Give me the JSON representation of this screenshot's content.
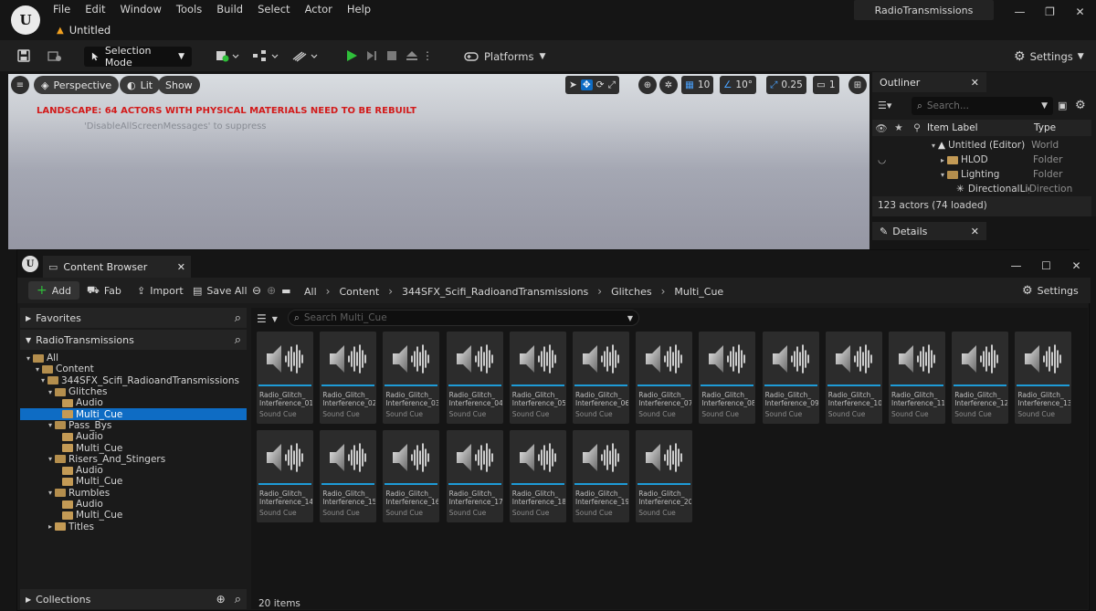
{
  "menu": [
    "File",
    "Edit",
    "Window",
    "Tools",
    "Build",
    "Select",
    "Actor",
    "Help"
  ],
  "doc_tab": "Untitled",
  "project_name": "RadioTransmissions",
  "toolbar": {
    "selection_mode": "Selection Mode",
    "platforms": "Platforms",
    "settings": "Settings"
  },
  "viewport": {
    "perspective": "Perspective",
    "lit": "Lit",
    "show": "Show",
    "warning": "LANDSCAPE: 64 ACTORS WITH PHYSICAL MATERIALS NEED TO BE REBUILT",
    "suppress_hint": "'DisableAllScreenMessages' to suppress",
    "grid_snap": "10",
    "rot_snap": "10°",
    "scale_snap": "0.25",
    "camera_speed": "1"
  },
  "outliner": {
    "title": "Outliner",
    "search_placeholder": "Search...",
    "col_label": "Item Label",
    "col_type": "Type",
    "rows": [
      {
        "label": "Untitled (Editor)",
        "type": "World"
      },
      {
        "label": "HLOD",
        "type": "Folder"
      },
      {
        "label": "Lighting",
        "type": "Folder"
      },
      {
        "label": "DirectionalLig",
        "type": "Direction"
      }
    ],
    "actors": "123 actors (74 loaded)"
  },
  "details": {
    "title": "Details"
  },
  "content_browser": {
    "title": "Content Browser",
    "add": "Add",
    "fab": "Fab",
    "import": "Import",
    "save_all": "Save All",
    "breadcrumb": [
      "All",
      "Content",
      "344SFX_Scifi_RadioandTransmissions",
      "Glitches",
      "Multi_Cue"
    ],
    "settings": "Settings",
    "favorites": "Favorites",
    "project_section": "RadioTransmissions",
    "collections": "Collections",
    "search_placeholder": "Search Multi_Cue",
    "item_count": "20 items",
    "tree": {
      "all": "All",
      "content": "Content",
      "pack": "344SFX_Scifi_RadioandTransmissions",
      "glitches": "Glitches",
      "glitches_audio": "Audio",
      "glitches_multi": "Multi_Cue",
      "pass_bys": "Pass_Bys",
      "pass_audio": "Audio",
      "pass_multi": "Multi_Cue",
      "risers": "Risers_And_Stingers",
      "risers_audio": "Audio",
      "risers_multi": "Multi_Cue",
      "rumbles": "Rumbles",
      "rumbles_audio": "Audio",
      "rumbles_multi": "Multi_Cue",
      "titles": "Titles"
    },
    "assets": [
      {
        "line1": "Radio_Glitch_",
        "line2": "Interference_01_",
        "type": "Sound Cue"
      },
      {
        "line1": "Radio_Glitch_",
        "line2": "Interference_02_",
        "type": "Sound Cue"
      },
      {
        "line1": "Radio_Glitch_",
        "line2": "Interference_03_",
        "type": "Sound Cue"
      },
      {
        "line1": "Radio_Glitch_",
        "line2": "Interference_04_",
        "type": "Sound Cue"
      },
      {
        "line1": "Radio_Glitch_",
        "line2": "Interference_05_",
        "type": "Sound Cue"
      },
      {
        "line1": "Radio_Glitch_",
        "line2": "Interference_06_",
        "type": "Sound Cue"
      },
      {
        "line1": "Radio_Glitch_",
        "line2": "Interference_07_",
        "type": "Sound Cue"
      },
      {
        "line1": "Radio_Glitch_",
        "line2": "Interference_08_",
        "type": "Sound Cue"
      },
      {
        "line1": "Radio_Glitch_",
        "line2": "Interference_09_",
        "type": "Sound Cue"
      },
      {
        "line1": "Radio_Glitch_",
        "line2": "Interference_10_",
        "type": "Sound Cue"
      },
      {
        "line1": "Radio_Glitch_",
        "line2": "Interference_11_",
        "type": "Sound Cue"
      },
      {
        "line1": "Radio_Glitch_",
        "line2": "Interference_12_",
        "type": "Sound Cue"
      },
      {
        "line1": "Radio_Glitch_",
        "line2": "Interference_13_",
        "type": "Sound Cue"
      },
      {
        "line1": "Radio_Glitch_",
        "line2": "Interference_14_",
        "type": "Sound Cue"
      },
      {
        "line1": "Radio_Glitch_",
        "line2": "Interference_15_",
        "type": "Sound Cue"
      },
      {
        "line1": "Radio_Glitch_",
        "line2": "Interference_16_",
        "type": "Sound Cue"
      },
      {
        "line1": "Radio_Glitch_",
        "line2": "Interference_17_",
        "type": "Sound Cue"
      },
      {
        "line1": "Radio_Glitch_",
        "line2": "Interference_18_",
        "type": "Sound Cue"
      },
      {
        "line1": "Radio_Glitch_",
        "line2": "Interference_19_",
        "type": "Sound Cue"
      },
      {
        "line1": "Radio_Glitch_",
        "line2": "Interference_20_",
        "type": "Sound Cue"
      }
    ]
  },
  "colors": {
    "accent_blue": "#1e9bd7",
    "selection_blue": "#0e6cc4",
    "play_green": "#2fbf3a",
    "warning_red": "#d21a1a",
    "folder": "#c39a55"
  },
  "icons": {
    "logo": "unreal-logo-icon",
    "asset_thumb": "speaker-waveform-icon"
  }
}
